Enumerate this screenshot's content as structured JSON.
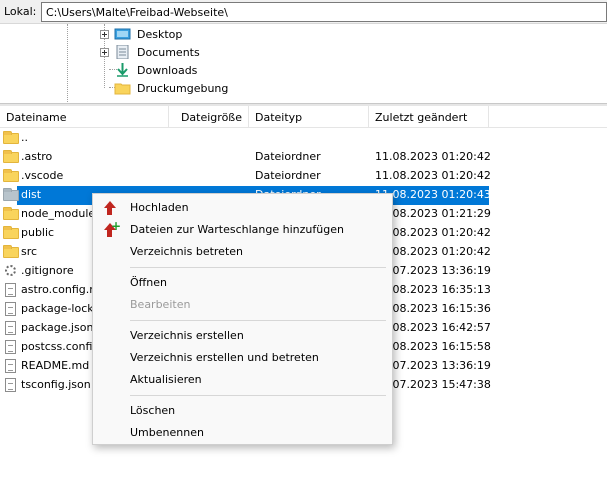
{
  "pathbar": {
    "label": "Lokal:",
    "value": "C:\\Users\\Malte\\Freibad-Webseite\\"
  },
  "tree": [
    {
      "label": "Desktop",
      "icon": "desktop-folder-icon",
      "expandable": true
    },
    {
      "label": "Documents",
      "icon": "documents-folder-icon",
      "expandable": true
    },
    {
      "label": "Downloads",
      "icon": "downloads-icon",
      "expandable": false
    },
    {
      "label": "Druckumgebung",
      "icon": "folder-icon",
      "expandable": false
    }
  ],
  "columns": {
    "name": "Dateiname",
    "size": "Dateigröße",
    "type": "Dateityp",
    "modified": "Zuletzt geändert"
  },
  "files": [
    {
      "name": "..",
      "type": "",
      "modified": "",
      "icon": "folder-icon"
    },
    {
      "name": ".astro",
      "type": "Dateiordner",
      "modified": "11.08.2023 01:20:42",
      "icon": "folder-icon"
    },
    {
      "name": ".vscode",
      "type": "Dateiordner",
      "modified": "11.08.2023 01:20:42",
      "icon": "folder-icon"
    },
    {
      "name": "dist",
      "type": "Dateiordner",
      "modified": "11.08.2023 01:20:43",
      "icon": "folder-icon",
      "selected": true
    },
    {
      "name": "node_modules",
      "type": "",
      "modified": "11.08.2023 01:21:29",
      "icon": "folder-icon"
    },
    {
      "name": "public",
      "type": "",
      "modified": "11.08.2023 01:20:42",
      "icon": "folder-icon"
    },
    {
      "name": "src",
      "type": "",
      "modified": "11.08.2023 01:20:42",
      "icon": "folder-icon"
    },
    {
      "name": ".gitignore",
      "type": "",
      "modified": "10.07.2023 13:36:19",
      "icon": "gear-file-icon"
    },
    {
      "name": "astro.config.mjs",
      "type": "",
      "modified": "11.08.2023 16:35:13",
      "icon": "file-icon"
    },
    {
      "name": "package-lock.json",
      "type": "",
      "modified": "11.08.2023 16:15:36",
      "icon": "file-icon"
    },
    {
      "name": "package.json",
      "type": "",
      "modified": "11.08.2023 16:42:57",
      "icon": "file-icon"
    },
    {
      "name": "postcss.config.cjs",
      "type": "",
      "modified": "11.08.2023 16:15:58",
      "icon": "file-icon"
    },
    {
      "name": "README.md",
      "type": "",
      "modified": "10.07.2023 13:36:19",
      "icon": "file-icon"
    },
    {
      "name": "tsconfig.json",
      "type": "",
      "modified": "10.07.2023 15:47:38",
      "icon": "file-icon"
    }
  ],
  "context_menu": {
    "groups": [
      [
        {
          "label": "Hochladen",
          "icon": "upload-icon",
          "enabled": true
        },
        {
          "label": "Dateien zur Warteschlange hinzufügen",
          "icon": "add-to-queue-icon",
          "enabled": true
        },
        {
          "label": "Verzeichnis betreten",
          "enabled": true
        }
      ],
      [
        {
          "label": "Öffnen",
          "enabled": true
        },
        {
          "label": "Bearbeiten",
          "enabled": false
        }
      ],
      [
        {
          "label": "Verzeichnis erstellen",
          "enabled": true
        },
        {
          "label": "Verzeichnis erstellen und betreten",
          "enabled": true
        },
        {
          "label": "Aktualisieren",
          "enabled": true
        }
      ],
      [
        {
          "label": "Löschen",
          "enabled": true
        },
        {
          "label": "Umbenennen",
          "enabled": true
        }
      ]
    ]
  },
  "colors": {
    "selection": "#0078d7",
    "folder": "#f9d45c",
    "upload_arrow": "#c0261f",
    "queue_plus": "#1f9d2a"
  }
}
